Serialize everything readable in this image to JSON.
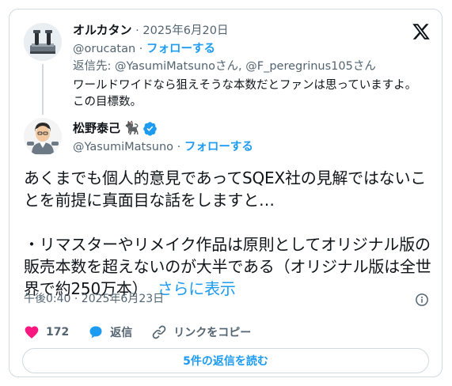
{
  "parent_tweet": {
    "display_name": "オルカタン",
    "date": "2025年6月20日",
    "handle": "@orucatan",
    "follow_label": "フォローする",
    "reply_prefix": "返信先: ",
    "reply_targets": "@YasumiMatsunoさん, @F_peregrinus105さん",
    "text_line1": "ワールドワイドなら狙えそうな本数だとファンは思っていますよ。",
    "text_line2": "この目標数。"
  },
  "main_tweet": {
    "display_name": "松野泰己",
    "name_emoji": "🐈‍⬛",
    "handle": "@YasumiMatsuno",
    "follow_label": "フォローする",
    "text_para1": "あくまでも個人的意見であってSQEX社の見解ではないことを前提に真面目な話をしますと…",
    "text_para2": "・リマスターやリメイク作品は原則としてオリジナル版の販売本数を超えないのが大半である（オリジナル版は全世界で約250万本）",
    "show_more": "さらに表示",
    "timestamp": "午後0:40 · 2025年6月23日"
  },
  "actions": {
    "like_count": "172",
    "reply_label": "返信",
    "copy_link_label": "リンクをコピー"
  },
  "read_replies_label": "5件の返信を読む",
  "separator": " · ",
  "colors": {
    "accent": "#1d9bf0",
    "like": "#f91880",
    "muted": "#536471",
    "border": "#cfd9de"
  },
  "icons": [
    "x-logo-icon",
    "verified-badge-icon",
    "heart-icon",
    "reply-bubble-icon",
    "link-icon",
    "info-icon"
  ]
}
